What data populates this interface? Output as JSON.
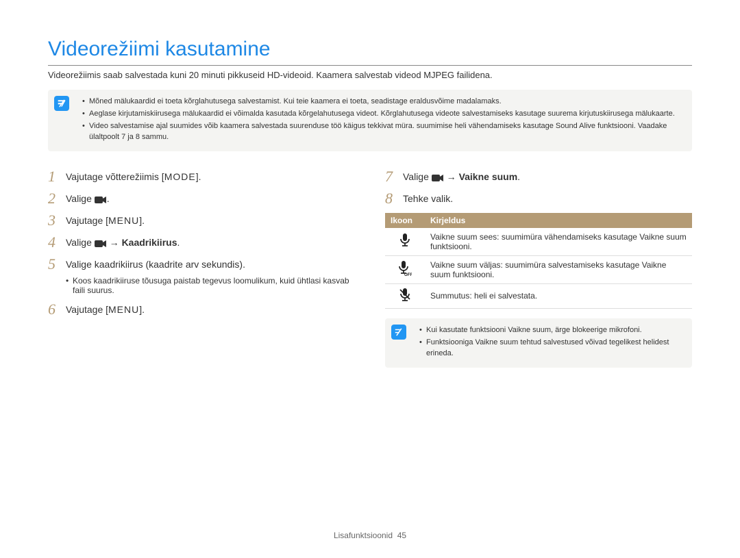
{
  "title": "Videorežiimi kasutamine",
  "intro": "Videorežiimis saab salvestada kuni 20 minuti pikkuseid HD-videoid. Kaamera salvestab videod MJPEG failidena.",
  "notes_top": [
    "Mõned mälukaardid ei toeta kõrglahutusega salvestamist. Kui teie kaamera ei toeta, seadistage eraldusvõime madalamaks.",
    "Aeglase kirjutamiskiirusega mälukaardid ei võimalda kasutada kõrgelahutusega videot. Kõrglahutusega videote salvestamiseks kasutage suurema kirjutuskiirusega mälukaarte.",
    "Video salvestamise ajal suumides võib kaamera salvestada suurenduse töö käigus tekkivat müra. suumimise heli vähendamiseks kasutage Sound Alive funktsiooni. Vaadake ülaltpoolt 7 ja 8 sammu."
  ],
  "steps_left": {
    "s1": {
      "pre": "Vajutage võtterežiimis [",
      "label": "MODE",
      "post": "]."
    },
    "s2": {
      "pre": "Valige ",
      "post": "."
    },
    "s3": {
      "pre": "Vajutage [",
      "label": "MENU",
      "post": "]."
    },
    "s4": {
      "pre": "Valige ",
      "arrow": "→",
      "bold": "Kaadrikiirus",
      "post": "."
    },
    "s5": {
      "text": "Valige kaadrikiirus (kaadrite arv sekundis)."
    },
    "s5_sub": "Koos kaadrikiiruse tõusuga paistab tegevus loomulikum, kuid ühtlasi kasvab faili suurus.",
    "s6": {
      "pre": "Vajutage [",
      "label": "MENU",
      "post": "]."
    }
  },
  "steps_right": {
    "s7": {
      "pre": "Valige ",
      "arrow": "→",
      "bold": "Vaikne suum",
      "post": "."
    },
    "s8": {
      "text": "Tehke valik."
    }
  },
  "table": {
    "h1": "Ikoon",
    "h2": "Kirjeldus",
    "row1_bold": "Vaikne suum sees",
    "row1": ": suumimüra vähendamiseks kasutage Vaikne suum funktsiooni.",
    "row2_bold": "Vaikne suum väljas",
    "row2": ": suumimüra salvestamiseks kasutage Vaikne suum funktsiooni.",
    "row3_bold": "Summutus",
    "row3": ": heli ei salvestata."
  },
  "notes_bottom": [
    "Kui kasutate funktsiooni Vaikne suum, ärge blokeerige mikrofoni.",
    "Funktsiooniga Vaikne suum tehtud salvestused võivad tegelikest helidest erineda."
  ],
  "footer": {
    "label": "Lisafunktsioonid",
    "page": "45"
  }
}
